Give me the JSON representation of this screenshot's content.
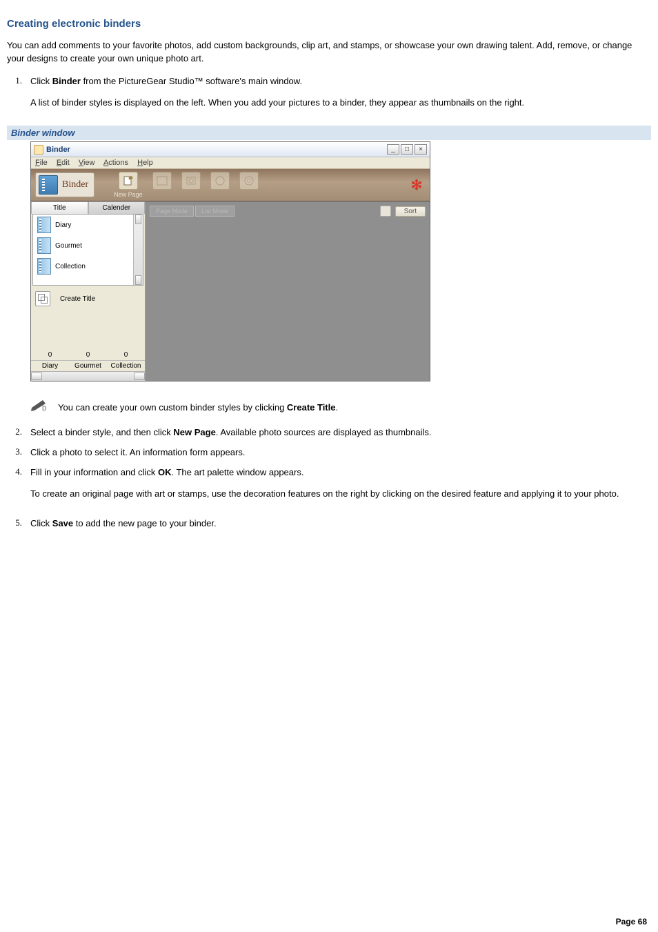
{
  "heading": "Creating electronic binders",
  "intro": "You can add comments to your favorite photos, add custom backgrounds, clip art, and stamps, or showcase your own drawing talent. Add, remove, or change your designs to create your own unique photo art.",
  "steps": {
    "s1_a": "Click ",
    "s1_b": "Binder",
    "s1_c": " from the PictureGear Studio™ software's main window.",
    "s1_p": "A list of binder styles is displayed on the left. When you add your pictures to a binder, they appear as thumbnails on the right.",
    "s2_a": "Select a binder style, and then click ",
    "s2_b": "New Page",
    "s2_c": ". Available photo sources are displayed as thumbnails.",
    "s3": "Click a photo to select it. An information form appears.",
    "s4_a": "Fill in your information and click ",
    "s4_b": "OK",
    "s4_c": ". The art palette window appears.",
    "s4_p": "To create an original page with art or stamps, use the decoration features on the right by clicking on the desired feature and applying it to your photo.",
    "s5_a": "Click ",
    "s5_b": "Save",
    "s5_c": " to add the new page to your binder."
  },
  "nums": {
    "n1": "1.",
    "n2": "2.",
    "n3": "3.",
    "n4": "4.",
    "n5": "5."
  },
  "caption": "Binder window",
  "note_a": "You can create your own custom binder styles by clicking ",
  "note_b": "Create Title",
  "note_c": ".",
  "footer": "Page 68",
  "app": {
    "title": "Binder",
    "menu": {
      "file": "File",
      "edit": "Edit",
      "view": "View",
      "actions": "Actions",
      "help": "Help"
    },
    "section_label": "Binder",
    "newpage_label": "New Page",
    "tabs": {
      "title": "Title",
      "calendar": "Calender"
    },
    "styles": {
      "diary": "Diary",
      "gourmet": "Gourmet",
      "collection": "Collection"
    },
    "create_title": "Create Title",
    "counts": {
      "c1": "0",
      "c2": "0",
      "c3": "0",
      "l1": "Diary",
      "l2": "Gourmet",
      "l3": "Collection"
    },
    "mode": {
      "page": "Page Mode",
      "list": "List Mode"
    },
    "sort": "Sort"
  }
}
